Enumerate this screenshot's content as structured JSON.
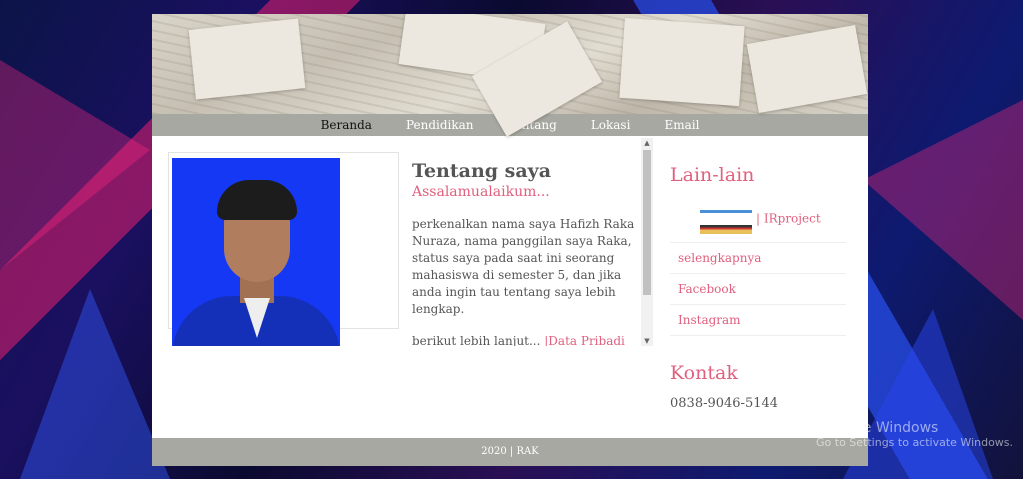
{
  "nav": {
    "items": [
      {
        "label": "Beranda",
        "active": true
      },
      {
        "label": "Pendidikan",
        "active": false
      },
      {
        "label": "Tentang",
        "active": false
      },
      {
        "label": "Lokasi",
        "active": false
      },
      {
        "label": "Email",
        "active": false
      }
    ]
  },
  "article": {
    "title": "Tentang saya",
    "subtitle": "Assalamualaikum...",
    "paragraph": "perkenalkan nama saya Hafizh Raka Nuraza, nama panggilan saya Raka, status saya pada saat ini seorang mahasiswa di semester 5, dan jika anda ingin tau tentang saya lebih lengkap.",
    "more_text": "berikut lebih lanjut...",
    "more_link": "|Data Pribadi"
  },
  "sidebar": {
    "other_title": "Lain-lain",
    "project_link": "| IRproject",
    "links": [
      "selengkapnya",
      "Facebook",
      "Instagram"
    ],
    "contact_title": "Kontak",
    "phone": "0838-9046-5144"
  },
  "footer": {
    "text": "2020 | RAK"
  },
  "watermark": {
    "line1": "Activate Windows",
    "line2": "Go to Settings to activate Windows."
  },
  "colors": {
    "accent": "#e0607e",
    "nav_bg": "#a8a8a2"
  }
}
